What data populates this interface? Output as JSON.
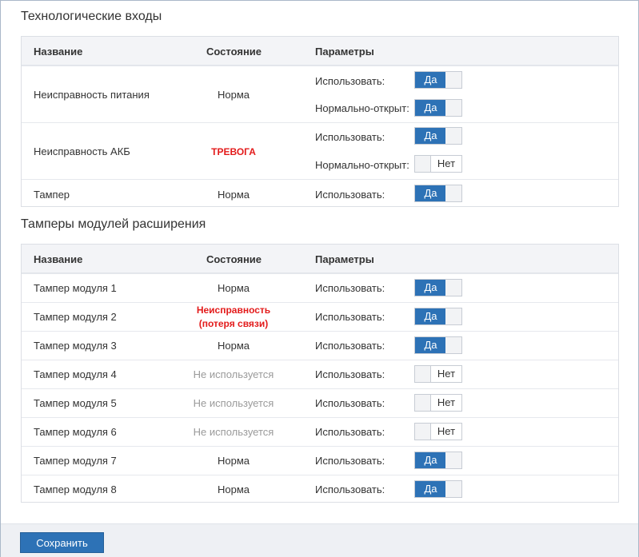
{
  "sections": {
    "tech_inputs": {
      "title": "Технологические входы",
      "headers": {
        "name": "Название",
        "state": "Состояние",
        "params": "Параметры"
      },
      "rows": [
        {
          "name": "Неисправность питания",
          "state": "Норма",
          "params": [
            {
              "label": "Использовать:",
              "value": "Да"
            },
            {
              "label": "Нормально-открыт:",
              "value": "Да"
            }
          ]
        },
        {
          "name": "Неисправность АКБ",
          "state": "ТРЕВОГА",
          "params": [
            {
              "label": "Использовать:",
              "value": "Да"
            },
            {
              "label": "Нормально-открыт:",
              "value": "Нет"
            }
          ]
        },
        {
          "name": "Тампер",
          "state": "Норма",
          "params": [
            {
              "label": "Использовать:",
              "value": "Да"
            }
          ]
        }
      ]
    },
    "expansion_tampers": {
      "title": "Тамперы модулей расширения",
      "headers": {
        "name": "Название",
        "state": "Состояние",
        "params": "Параметры"
      },
      "rows": [
        {
          "name": "Тампер модуля 1",
          "state": "Норма",
          "label": "Использовать:",
          "value": "Да"
        },
        {
          "name": "Тампер модуля 2",
          "state_line1": "Неисправность",
          "state_line2": "(потеря связи)",
          "label": "Использовать:",
          "value": "Да"
        },
        {
          "name": "Тампер модуля 3",
          "state": "Норма",
          "label": "Использовать:",
          "value": "Да"
        },
        {
          "name": "Тампер модуля 4",
          "state": "Не используется",
          "label": "Использовать:",
          "value": "Нет"
        },
        {
          "name": "Тампер модуля 5",
          "state": "Не используется",
          "label": "Использовать:",
          "value": "Нет"
        },
        {
          "name": "Тампер модуля 6",
          "state": "Не используется",
          "label": "Использовать:",
          "value": "Нет"
        },
        {
          "name": "Тампер модуля 7",
          "state": "Норма",
          "label": "Использовать:",
          "value": "Да"
        },
        {
          "name": "Тампер модуля 8",
          "state": "Норма",
          "label": "Использовать:",
          "value": "Да"
        }
      ]
    }
  },
  "footer": {
    "save_label": "Сохранить"
  },
  "colors": {
    "accent": "#2d72b6",
    "alarm": "#e31b1b",
    "inactive": "#9a9a9a"
  }
}
